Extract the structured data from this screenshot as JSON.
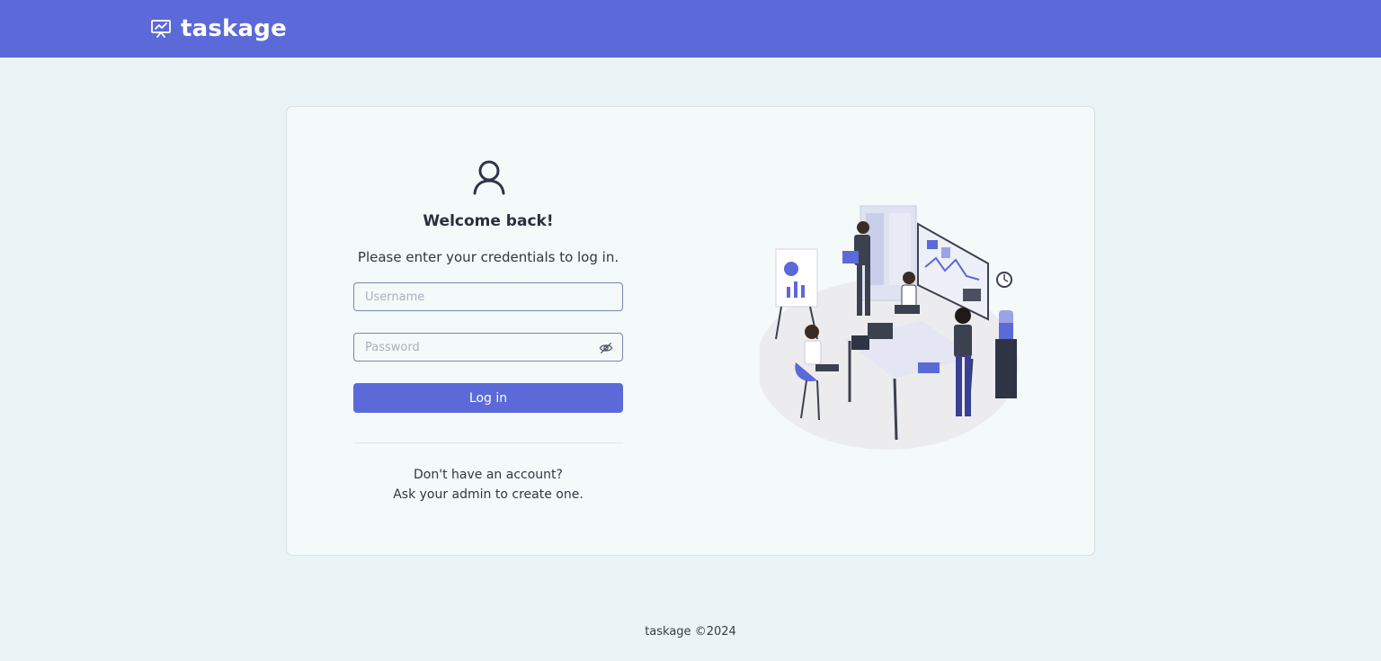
{
  "header": {
    "brand_name": "taskage",
    "brand_icon": "presentation-chart-icon"
  },
  "login": {
    "user_icon": "user-icon",
    "title": "Welcome back!",
    "subtitle": "Please enter your credentials to log in.",
    "username_placeholder": "Username",
    "password_placeholder": "Password",
    "password_toggle_icon": "eye-off-icon",
    "submit_label": "Log in",
    "no_account_line1": "Don't have an account?",
    "no_account_line2": "Ask your admin to create one."
  },
  "illustration": {
    "icon": "team-meeting-illustration"
  },
  "footer": {
    "text": "taskage ©2024"
  },
  "colors": {
    "primary": "#5c69d8",
    "page_bg": "#eaf3f5",
    "card_bg": "#f4f9fa"
  }
}
